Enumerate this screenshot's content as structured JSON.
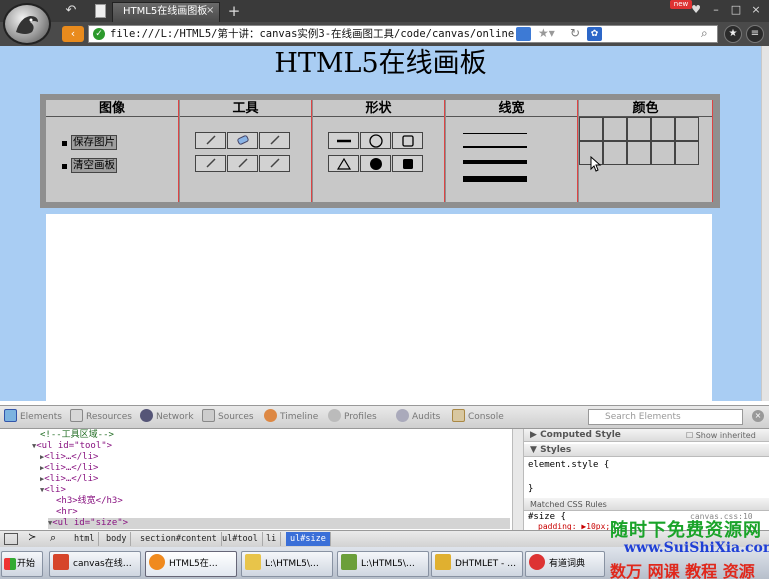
{
  "browser": {
    "tab_title": "HTML5在线画图板",
    "url": "file:///L:/HTML5/第十讲：canvas实例3-在线画图工具/code/canvas/online",
    "new_badge": "new"
  },
  "page": {
    "title": "HTML5在线画板",
    "sections": {
      "image": {
        "heading": "图像",
        "save_label": "保存图片",
        "clear_label": "清空画板"
      },
      "tools": {
        "heading": "工具"
      },
      "shapes": {
        "heading": "形状"
      },
      "linewidth": {
        "heading": "线宽"
      },
      "colors": {
        "heading": "颜色"
      }
    }
  },
  "devtools": {
    "tabs": [
      "Elements",
      "Resources",
      "Network",
      "Sources",
      "Timeline",
      "Profiles",
      "Audits",
      "Console"
    ],
    "search_placeholder": "Search Elements",
    "dom_lines": [
      {
        "indent": 40,
        "tri": "",
        "text": "<!--工具区域-->"
      },
      {
        "indent": 32,
        "tri": "▼",
        "text": "<ul id=\"tool\">"
      },
      {
        "indent": 40,
        "tri": "▶",
        "text": "<li>…</li>"
      },
      {
        "indent": 40,
        "tri": "▶",
        "text": "<li>…</li>"
      },
      {
        "indent": 40,
        "tri": "▶",
        "text": "<li>…</li>"
      },
      {
        "indent": 40,
        "tri": "▼",
        "text": "<li>"
      },
      {
        "indent": 56,
        "tri": "",
        "text": "<h3>线宽</h3>"
      },
      {
        "indent": 56,
        "tri": "",
        "text": "<hr>"
      },
      {
        "indent": 48,
        "tri": "▼",
        "text": "<ul id=\"size\">"
      }
    ],
    "side": {
      "computed_label": "Computed Style",
      "show_inherited": "Show inherited",
      "styles_label": "Styles",
      "element_style": "element.style {",
      "close_brace": "}",
      "matched_label": "Matched CSS Rules",
      "rule_selector": "#size {",
      "rule_source": "canvas.css:10",
      "rule_prop": "padding: ▶10px;"
    },
    "breadcrumbs": [
      "html",
      "body",
      "section#content",
      "ul#tool",
      "li",
      "ul#size"
    ]
  },
  "taskbar": {
    "start_label": "开始",
    "items": [
      "canvas在线…",
      "HTML5在…",
      "L:\\HTML5\\…",
      "L:\\HTML5\\…",
      "DHTMLET - …",
      "有道词典"
    ]
  },
  "watermark": {
    "line1": "随时下免费资源网",
    "line2": "www.SuiShiXia.com",
    "line3": "数万 网课 教程 资源"
  },
  "colors": {
    "page_bg": "#a9cdf3",
    "panel_bg": "#c8c8c8",
    "section_divider": "#dd4444"
  }
}
